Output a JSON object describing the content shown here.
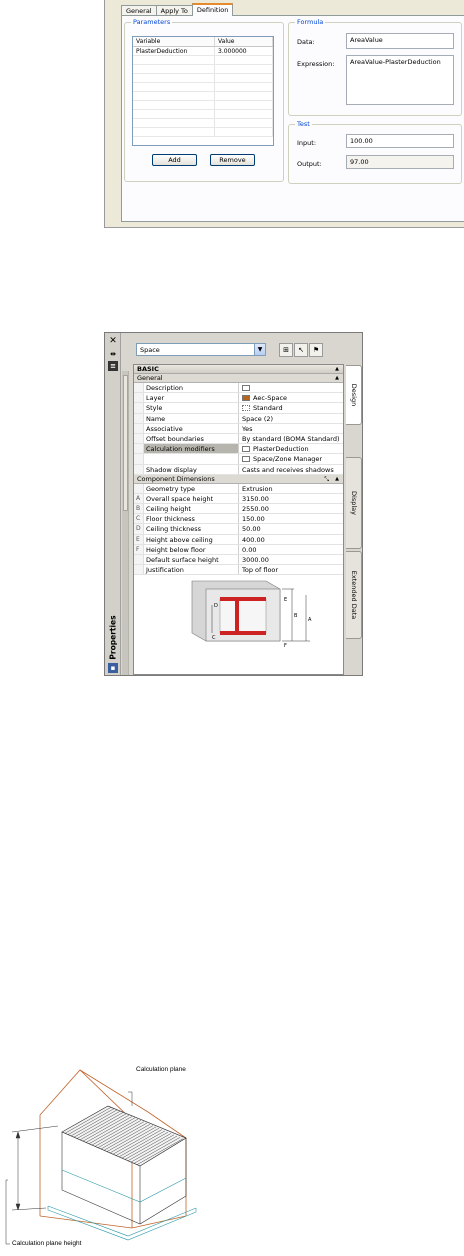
{
  "dialog": {
    "tabs": [
      "General",
      "Apply To",
      "Definition"
    ],
    "parameters": {
      "legend": "Parameters",
      "columns": [
        "Variable",
        "Value"
      ],
      "rows": [
        [
          "PlasterDeduction",
          "3.000000"
        ]
      ],
      "add_label": "Add",
      "remove_label": "Remove"
    },
    "formula": {
      "legend": "Formula",
      "data_label": "Data:",
      "data_value": "AreaValue",
      "expression_label": "Expression:",
      "expression_value": "AreaValue-PlasterDeduction"
    },
    "test": {
      "legend": "Test",
      "input_label": "Input:",
      "input_value": "100.00",
      "output_label": "Output:",
      "output_value": "97.00"
    }
  },
  "palette": {
    "title": "Properties",
    "object_type": "Space",
    "tabs": [
      "Design",
      "Display",
      "Extended Data"
    ],
    "category": "BASIC",
    "general": {
      "title": "General",
      "rows": [
        {
          "name": "Description",
          "value": ""
        },
        {
          "name": "Layer",
          "value": "Aec-Space"
        },
        {
          "name": "Style",
          "value": "Standard"
        },
        {
          "name": "Name",
          "value": "Space (2)"
        },
        {
          "name": "Associative",
          "value": "Yes"
        },
        {
          "name": "Offset boundaries",
          "value": "By standard (BOMA Standard)"
        },
        {
          "name": "Calculation modifiers",
          "value": "PlasterDeduction"
        },
        {
          "name": "",
          "value": "Space/Zone Manager"
        },
        {
          "name": "Shadow display",
          "value": "Casts and receives shadows"
        }
      ]
    },
    "component_dimensions": {
      "title": "Component Dimensions",
      "rows": [
        {
          "mark": "",
          "name": "Geometry type",
          "value": "Extrusion"
        },
        {
          "mark": "A",
          "name": "Overall space height",
          "value": "3150.00"
        },
        {
          "mark": "B",
          "name": "Ceiling height",
          "value": "2550.00"
        },
        {
          "mark": "C",
          "name": "Floor thickness",
          "value": "150.00"
        },
        {
          "mark": "D",
          "name": "Ceiling thickness",
          "value": "50.00"
        },
        {
          "mark": "E",
          "name": "Height above ceiling",
          "value": "400.00"
        },
        {
          "mark": "F",
          "name": "Height below floor",
          "value": "0.00"
        },
        {
          "mark": "",
          "name": "Default surface height",
          "value": "3000.00"
        },
        {
          "mark": "",
          "name": "Justification",
          "value": "Top of floor"
        }
      ],
      "diagram_letters": [
        "D",
        "E",
        "B",
        "A",
        "C",
        "F"
      ]
    },
    "colors": {
      "layer_swatch": "#b5651d",
      "accent_red": "#cc2222"
    }
  },
  "illustration": {
    "callout_top": "Calculation plane",
    "callout_bottom": "Calculation plane height"
  }
}
